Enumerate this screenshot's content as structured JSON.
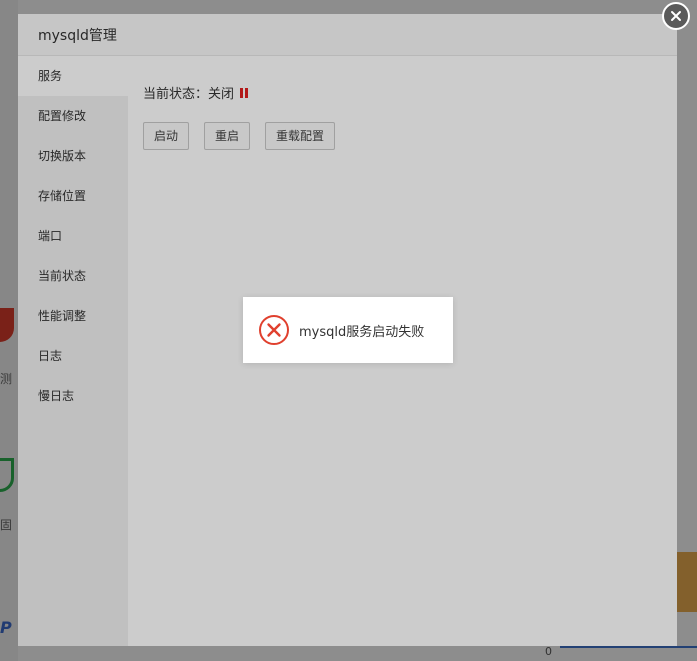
{
  "background": {
    "text_fragments": [
      "测",
      "固"
    ],
    "brand_fragment": "P",
    "axis_zero": "0"
  },
  "dialog": {
    "title": "mysqld管理",
    "menu": [
      {
        "label": "服务",
        "active": true
      },
      {
        "label": "配置修改"
      },
      {
        "label": "切换版本"
      },
      {
        "label": "存储位置"
      },
      {
        "label": "端口"
      },
      {
        "label": "当前状态"
      },
      {
        "label": "性能调整"
      },
      {
        "label": "日志"
      },
      {
        "label": "慢日志"
      }
    ],
    "status_label": "当前状态：关闭",
    "status_icon": "pause-icon",
    "status_color": "#e02020",
    "buttons": {
      "start": "启动",
      "restart": "重启",
      "reload": "重载配置"
    }
  },
  "toast": {
    "message": "mysqld服务启动失败",
    "icon": "error-circle-x-icon",
    "icon_color": "#e0402e"
  },
  "close_icon": "close-icon"
}
